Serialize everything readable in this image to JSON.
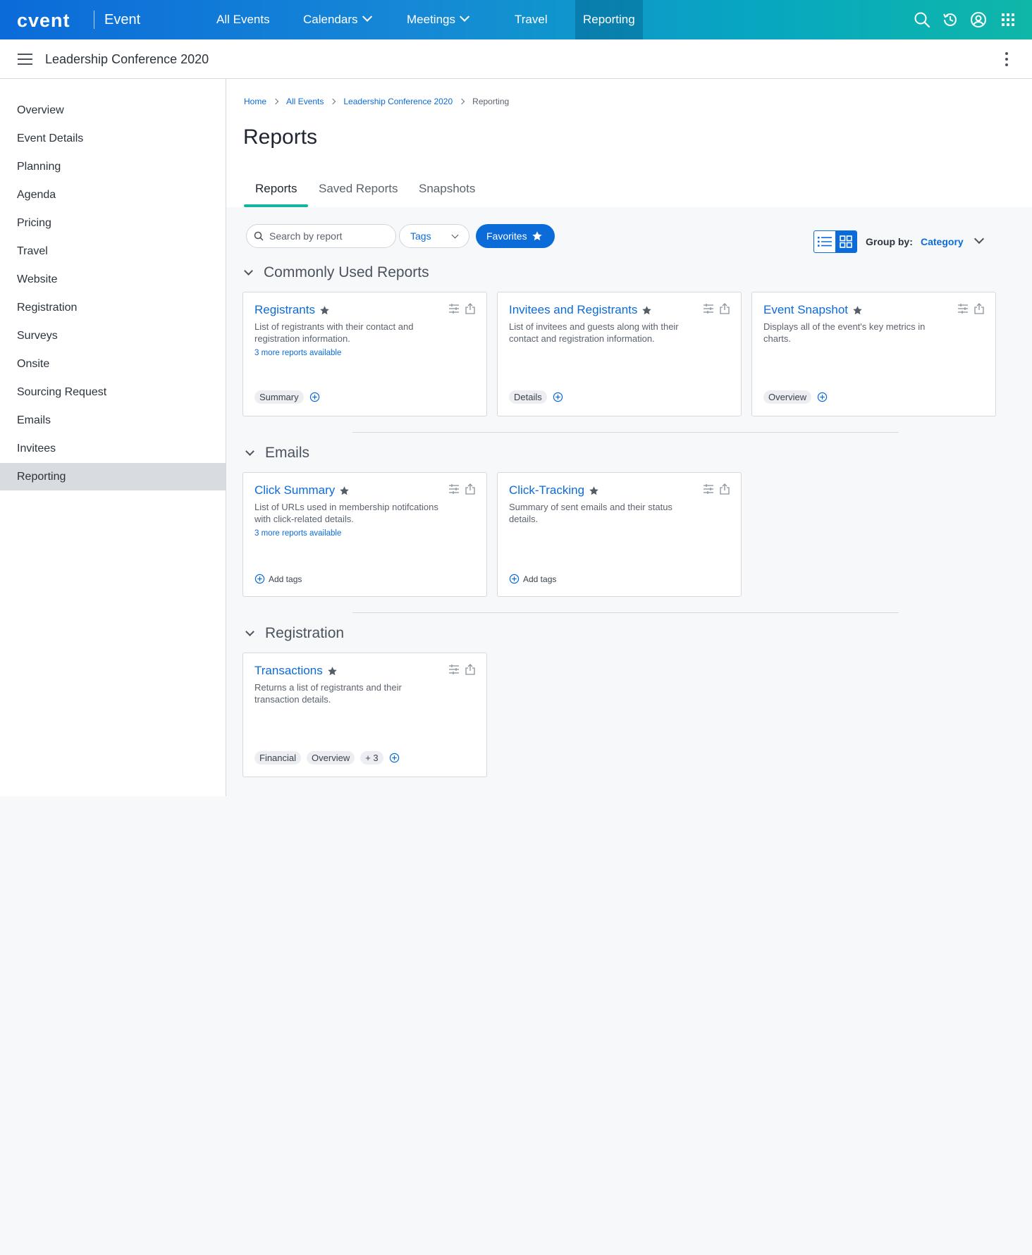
{
  "brand": {
    "logo": "cvent",
    "product": "Event"
  },
  "nav": {
    "items": [
      {
        "label": "All Events"
      },
      {
        "label": "Calendars"
      },
      {
        "label": "Meetings"
      },
      {
        "label": "Travel"
      },
      {
        "label": "Reporting"
      }
    ],
    "active": "Reporting"
  },
  "event_bar": {
    "title": "Leadership Conference 2020"
  },
  "sidebar": {
    "items": [
      {
        "label": "Overview"
      },
      {
        "label": "Event Details"
      },
      {
        "label": "Planning"
      },
      {
        "label": "Agenda"
      },
      {
        "label": "Pricing"
      },
      {
        "label": "Travel"
      },
      {
        "label": "Website"
      },
      {
        "label": "Registration"
      },
      {
        "label": "Surveys"
      },
      {
        "label": "Onsite"
      },
      {
        "label": "Sourcing Request"
      },
      {
        "label": "Emails"
      },
      {
        "label": "Invitees"
      },
      {
        "label": "Reporting"
      }
    ],
    "active": "Reporting"
  },
  "breadcrumb": [
    "Home",
    "All Events",
    "Leadership Conference 2020",
    "Reporting"
  ],
  "page": {
    "title": "Reports"
  },
  "tabs": [
    {
      "label": "Reports"
    },
    {
      "label": "Saved Reports"
    },
    {
      "label": "Snapshots"
    }
  ],
  "toolbar": {
    "search_placeholder": "Search by report",
    "tags_label": "Tags",
    "favorites_label": "Favorites",
    "group_by_label": "Group  by:",
    "group_by_value": "Category"
  },
  "sections": [
    {
      "title": "Commonly Used Reports",
      "cards": [
        {
          "title": "Registrants",
          "desc": "List of registrants with their contact and registration information.",
          "more": "3 more reports available",
          "tags": [
            "Summary"
          ]
        },
        {
          "title": "Invitees and Registrants",
          "desc": "List of invitees and guests along with their contact and registration information.",
          "more": "",
          "tags": [
            "Details"
          ]
        },
        {
          "title": "Event Snapshot",
          "desc": "Displays all of the event's key metrics in charts.",
          "more": "",
          "tags": [
            "Overview"
          ]
        }
      ]
    },
    {
      "title": "Emails",
      "cards": [
        {
          "title": "Click Summary",
          "desc": "List of URLs used in membership notifcations with click-related details.",
          "more": "3 more reports available",
          "tags": [],
          "add_tags": "Add tags"
        },
        {
          "title": "Click-Tracking",
          "desc": "Summary of sent emails and their status details.",
          "more": "",
          "tags": [],
          "add_tags": "Add tags"
        }
      ]
    },
    {
      "title": "Registration",
      "cards": [
        {
          "title": "Transactions",
          "desc": "Returns a list of registrants and their transaction details.",
          "more": "",
          "tags": [
            "Financial",
            "Overview",
            "+ 3"
          ]
        }
      ]
    }
  ],
  "colors": {
    "accent": "#0b6bd9",
    "tab_underline": "#13b5a0",
    "active_side": "#d8dbdf"
  }
}
